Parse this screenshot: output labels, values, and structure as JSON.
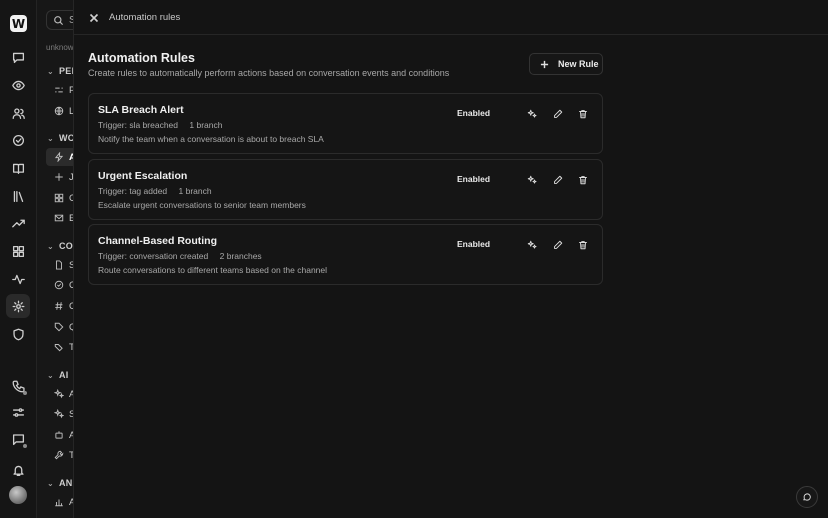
{
  "rail": {
    "logo": "W",
    "icons": [
      "chat-icon",
      "eye-icon",
      "users-icon",
      "check-circle-icon",
      "book-icon",
      "library-icon",
      "trend-icon",
      "grid-icon",
      "activity-icon",
      "settings-icon",
      "shield-icon",
      "phone-icon",
      "sliders-icon",
      "message-square-icon",
      "bell-icon"
    ]
  },
  "sidebar": {
    "search_label": "S",
    "workspace": "unknown",
    "sections": [
      {
        "label": "PER",
        "items": [
          "P",
          "L"
        ]
      },
      {
        "label": "WO",
        "items": [
          "A",
          "J",
          "C",
          "E"
        ]
      },
      {
        "label": "CON",
        "items": [
          "S",
          "C",
          "C",
          "Q",
          "T"
        ]
      },
      {
        "label": "AI",
        "items": [
          "A",
          "S",
          "A",
          "T"
        ]
      },
      {
        "label": "ANA",
        "items": [
          "A"
        ]
      }
    ]
  },
  "topbar": {
    "title": "Automation rules"
  },
  "page": {
    "title": "Automation Rules",
    "subtitle": "Create rules to automatically perform actions based on conversation events and conditions",
    "new_rule_label": "New Rule"
  },
  "rules": [
    {
      "name": "SLA Breach Alert",
      "trigger": "Trigger: sla breached",
      "branches": "1 branch",
      "description": "Notify the team when a conversation is about to breach SLA",
      "status": "Enabled"
    },
    {
      "name": "Urgent Escalation",
      "trigger": "Trigger: tag added",
      "branches": "1 branch",
      "description": "Escalate urgent conversations to senior team members",
      "status": "Enabled"
    },
    {
      "name": "Channel-Based Routing",
      "trigger": "Trigger: conversation created",
      "branches": "2 branches",
      "description": "Route conversations to different teams based on the channel",
      "status": "Enabled"
    }
  ],
  "colors": {
    "background": "#141414",
    "card_border": "#2b2b2b",
    "text": "#f0f0f0",
    "muted": "#a9a9a9"
  }
}
